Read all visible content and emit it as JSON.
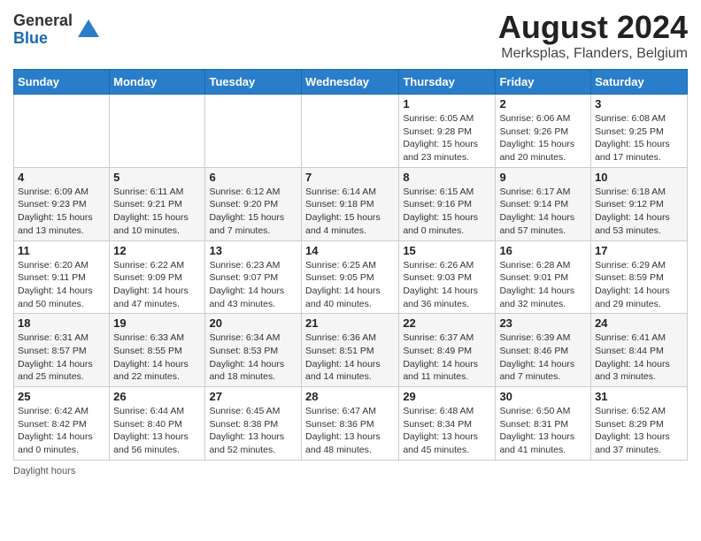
{
  "header": {
    "logo_general": "General",
    "logo_blue": "Blue",
    "title": "August 2024",
    "subtitle": "Merksplas, Flanders, Belgium"
  },
  "days_of_week": [
    "Sunday",
    "Monday",
    "Tuesday",
    "Wednesday",
    "Thursday",
    "Friday",
    "Saturday"
  ],
  "weeks": [
    [
      {
        "day": "",
        "info": ""
      },
      {
        "day": "",
        "info": ""
      },
      {
        "day": "",
        "info": ""
      },
      {
        "day": "",
        "info": ""
      },
      {
        "day": "1",
        "info": "Sunrise: 6:05 AM\nSunset: 9:28 PM\nDaylight: 15 hours and 23 minutes."
      },
      {
        "day": "2",
        "info": "Sunrise: 6:06 AM\nSunset: 9:26 PM\nDaylight: 15 hours and 20 minutes."
      },
      {
        "day": "3",
        "info": "Sunrise: 6:08 AM\nSunset: 9:25 PM\nDaylight: 15 hours and 17 minutes."
      }
    ],
    [
      {
        "day": "4",
        "info": "Sunrise: 6:09 AM\nSunset: 9:23 PM\nDaylight: 15 hours and 13 minutes."
      },
      {
        "day": "5",
        "info": "Sunrise: 6:11 AM\nSunset: 9:21 PM\nDaylight: 15 hours and 10 minutes."
      },
      {
        "day": "6",
        "info": "Sunrise: 6:12 AM\nSunset: 9:20 PM\nDaylight: 15 hours and 7 minutes."
      },
      {
        "day": "7",
        "info": "Sunrise: 6:14 AM\nSunset: 9:18 PM\nDaylight: 15 hours and 4 minutes."
      },
      {
        "day": "8",
        "info": "Sunrise: 6:15 AM\nSunset: 9:16 PM\nDaylight: 15 hours and 0 minutes."
      },
      {
        "day": "9",
        "info": "Sunrise: 6:17 AM\nSunset: 9:14 PM\nDaylight: 14 hours and 57 minutes."
      },
      {
        "day": "10",
        "info": "Sunrise: 6:18 AM\nSunset: 9:12 PM\nDaylight: 14 hours and 53 minutes."
      }
    ],
    [
      {
        "day": "11",
        "info": "Sunrise: 6:20 AM\nSunset: 9:11 PM\nDaylight: 14 hours and 50 minutes."
      },
      {
        "day": "12",
        "info": "Sunrise: 6:22 AM\nSunset: 9:09 PM\nDaylight: 14 hours and 47 minutes."
      },
      {
        "day": "13",
        "info": "Sunrise: 6:23 AM\nSunset: 9:07 PM\nDaylight: 14 hours and 43 minutes."
      },
      {
        "day": "14",
        "info": "Sunrise: 6:25 AM\nSunset: 9:05 PM\nDaylight: 14 hours and 40 minutes."
      },
      {
        "day": "15",
        "info": "Sunrise: 6:26 AM\nSunset: 9:03 PM\nDaylight: 14 hours and 36 minutes."
      },
      {
        "day": "16",
        "info": "Sunrise: 6:28 AM\nSunset: 9:01 PM\nDaylight: 14 hours and 32 minutes."
      },
      {
        "day": "17",
        "info": "Sunrise: 6:29 AM\nSunset: 8:59 PM\nDaylight: 14 hours and 29 minutes."
      }
    ],
    [
      {
        "day": "18",
        "info": "Sunrise: 6:31 AM\nSunset: 8:57 PM\nDaylight: 14 hours and 25 minutes."
      },
      {
        "day": "19",
        "info": "Sunrise: 6:33 AM\nSunset: 8:55 PM\nDaylight: 14 hours and 22 minutes."
      },
      {
        "day": "20",
        "info": "Sunrise: 6:34 AM\nSunset: 8:53 PM\nDaylight: 14 hours and 18 minutes."
      },
      {
        "day": "21",
        "info": "Sunrise: 6:36 AM\nSunset: 8:51 PM\nDaylight: 14 hours and 14 minutes."
      },
      {
        "day": "22",
        "info": "Sunrise: 6:37 AM\nSunset: 8:49 PM\nDaylight: 14 hours and 11 minutes."
      },
      {
        "day": "23",
        "info": "Sunrise: 6:39 AM\nSunset: 8:46 PM\nDaylight: 14 hours and 7 minutes."
      },
      {
        "day": "24",
        "info": "Sunrise: 6:41 AM\nSunset: 8:44 PM\nDaylight: 14 hours and 3 minutes."
      }
    ],
    [
      {
        "day": "25",
        "info": "Sunrise: 6:42 AM\nSunset: 8:42 PM\nDaylight: 14 hours and 0 minutes."
      },
      {
        "day": "26",
        "info": "Sunrise: 6:44 AM\nSunset: 8:40 PM\nDaylight: 13 hours and 56 minutes."
      },
      {
        "day": "27",
        "info": "Sunrise: 6:45 AM\nSunset: 8:38 PM\nDaylight: 13 hours and 52 minutes."
      },
      {
        "day": "28",
        "info": "Sunrise: 6:47 AM\nSunset: 8:36 PM\nDaylight: 13 hours and 48 minutes."
      },
      {
        "day": "29",
        "info": "Sunrise: 6:48 AM\nSunset: 8:34 PM\nDaylight: 13 hours and 45 minutes."
      },
      {
        "day": "30",
        "info": "Sunrise: 6:50 AM\nSunset: 8:31 PM\nDaylight: 13 hours and 41 minutes."
      },
      {
        "day": "31",
        "info": "Sunrise: 6:52 AM\nSunset: 8:29 PM\nDaylight: 13 hours and 37 minutes."
      }
    ]
  ],
  "footer": "Daylight hours"
}
